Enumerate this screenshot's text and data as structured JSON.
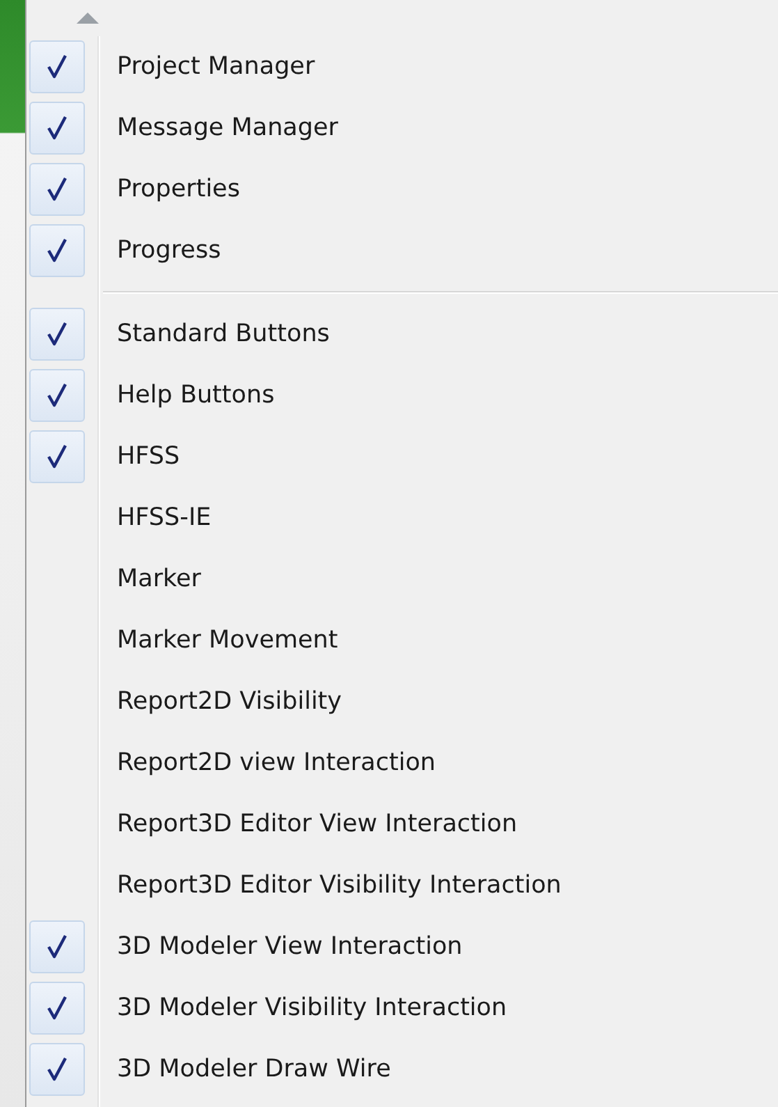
{
  "menu": {
    "groups": [
      {
        "items": [
          {
            "label": "Project Manager",
            "checked": true
          },
          {
            "label": "Message Manager",
            "checked": true
          },
          {
            "label": "Properties",
            "checked": true
          },
          {
            "label": "Progress",
            "checked": true
          }
        ]
      },
      {
        "items": [
          {
            "label": "Standard Buttons",
            "checked": true
          },
          {
            "label": "Help Buttons",
            "checked": true
          },
          {
            "label": "HFSS",
            "checked": true
          },
          {
            "label": "HFSS-IE",
            "checked": false
          },
          {
            "label": "Marker",
            "checked": false
          },
          {
            "label": "Marker Movement",
            "checked": false
          },
          {
            "label": "Report2D Visibility",
            "checked": false
          },
          {
            "label": "Report2D view Interaction",
            "checked": false
          },
          {
            "label": "Report3D Editor View Interaction",
            "checked": false
          },
          {
            "label": "Report3D Editor Visibility Interaction",
            "checked": false
          },
          {
            "label": "3D Modeler View Interaction",
            "checked": true
          },
          {
            "label": "3D Modeler Visibility Interaction",
            "checked": true
          },
          {
            "label": "3D Modeler Draw Wire",
            "checked": true
          }
        ]
      }
    ]
  }
}
